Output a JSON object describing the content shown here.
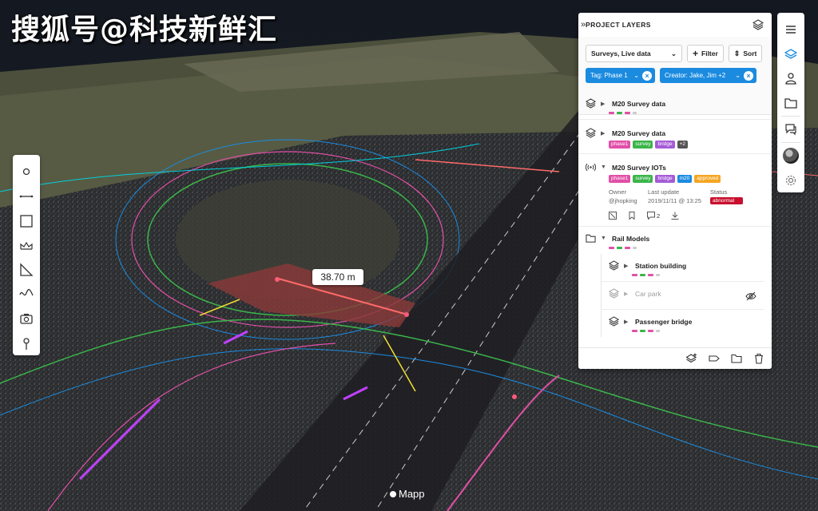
{
  "watermark": "搜狐号@科技新鲜汇",
  "measurement": "38.70 m",
  "brand": "Mapp",
  "colors": {
    "accent": "#1b8be0",
    "swatch_pink": "#e14fa7",
    "swatch_green": "#3bb54a",
    "tag_phase": "#e14fa7",
    "tag_survey": "#3bb54a",
    "tag_bridge": "#a55bd6",
    "tag_m20": "#1b8be0",
    "tag_approved": "#f5a623",
    "status_abnormal": "#c8102e"
  },
  "toolbar": {
    "tools": [
      "point-icon",
      "line-icon",
      "area-icon",
      "volume-icon",
      "angle-icon",
      "profile-icon",
      "camera-icon",
      "pin-icon"
    ]
  },
  "rail": {
    "buttons": [
      "menu-icon",
      "layers-icon",
      "user-icon",
      "folder-icon",
      "comments-icon",
      "avatar",
      "settings-icon"
    ]
  },
  "panel": {
    "collapse": "»",
    "title": "PROJECT LAYERS",
    "source_select": "Surveys, Live data",
    "filter_label": "Filter",
    "sort_label": "Sort",
    "chips": [
      {
        "label": "Tag: Phase 1"
      },
      {
        "label": "Creator: Jake, Jim +2"
      }
    ],
    "layers": [
      {
        "name": "M20 Survey data"
      },
      {
        "name": "M20 Survey data",
        "tags": [
          "phase1",
          "survey",
          "bridge"
        ],
        "more": "+2"
      },
      {
        "name": "M20 Survey IOTs",
        "tags": [
          "phase1",
          "survey",
          "bridge",
          "m20",
          "approved"
        ],
        "owner_label": "Owner",
        "owner": "@jhopking",
        "update_label": "Last update",
        "update": "2019/11/11 @ 13:25",
        "status_label": "Status",
        "status": "abnormal",
        "comments": "2"
      },
      {
        "name": "Rail Models",
        "children": [
          {
            "name": "Station building"
          },
          {
            "name": "Car park"
          },
          {
            "name": "Passenger bridge"
          }
        ]
      }
    ]
  }
}
